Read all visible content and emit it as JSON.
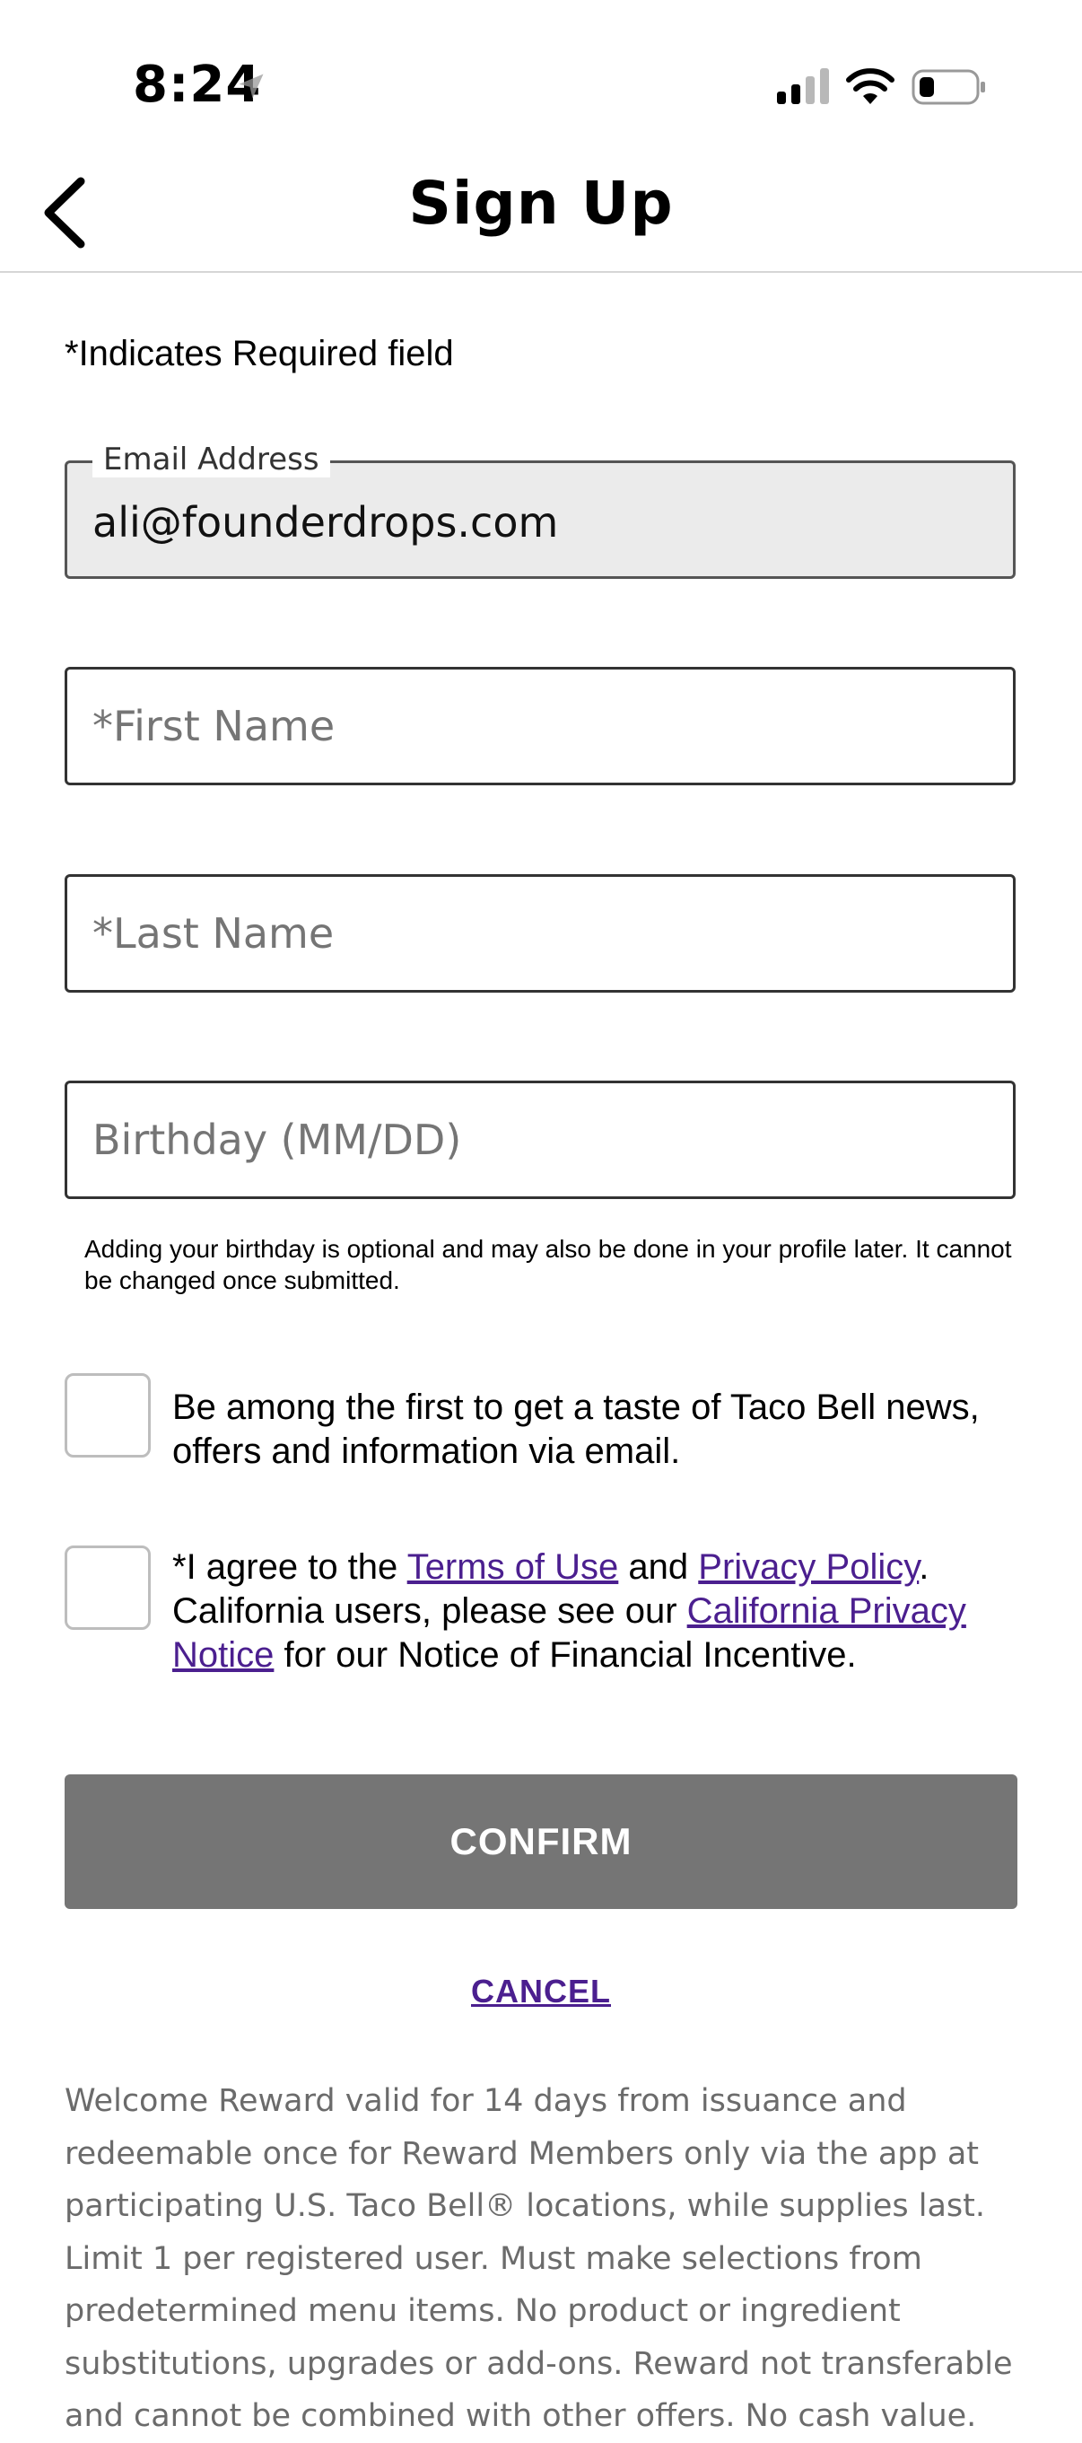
{
  "status_bar": {
    "time": "8:24"
  },
  "header": {
    "title": "Sign Up"
  },
  "form": {
    "required_note": "*Indicates Required field",
    "email": {
      "label": "Email Address",
      "value": "ali@founderdrops.com"
    },
    "first_name": {
      "placeholder": "*First Name",
      "value": ""
    },
    "last_name": {
      "placeholder": "*Last Name",
      "value": ""
    },
    "birthday": {
      "placeholder": "Birthday (MM/DD)",
      "value": ""
    },
    "birthday_helper": "Adding your birthday is optional and may also be done in your profile later. It cannot be changed once submitted.",
    "marketing_opt_in": {
      "checked": false,
      "text": "Be among the first to get a taste of Taco Bell news, offers and information via email."
    },
    "terms": {
      "checked": false,
      "text_1": "*I agree to the ",
      "terms_link": "Terms of Use",
      "text_2": " and ",
      "privacy_link": "Privacy Policy",
      "text_3": ". California users, please see our ",
      "ca_privacy_link": "California Privacy Notice",
      "text_4": " for our Notice of Financial Incentive."
    },
    "confirm_label": "CONFIRM",
    "cancel_label": "CANCEL"
  },
  "legal_text": "Welcome Reward valid for 14 days from issuance and redeemable once for Reward Members only via the app at participating U.S. Taco Bell® locations, while supplies last. Limit 1 per registered user. Must make selections from predetermined menu items. No product or ingredient substitutions, upgrades or add-ons. Reward not transferable and cannot be combined with other offers. No cash value.",
  "colors": {
    "link": "#4b1f8f",
    "confirm_disabled": "#757575",
    "legal_text": "#6b6b6b"
  },
  "icons": [
    "location-arrow-icon",
    "cellular-signal-icon",
    "wifi-icon",
    "battery-icon",
    "chevron-left-icon"
  ]
}
